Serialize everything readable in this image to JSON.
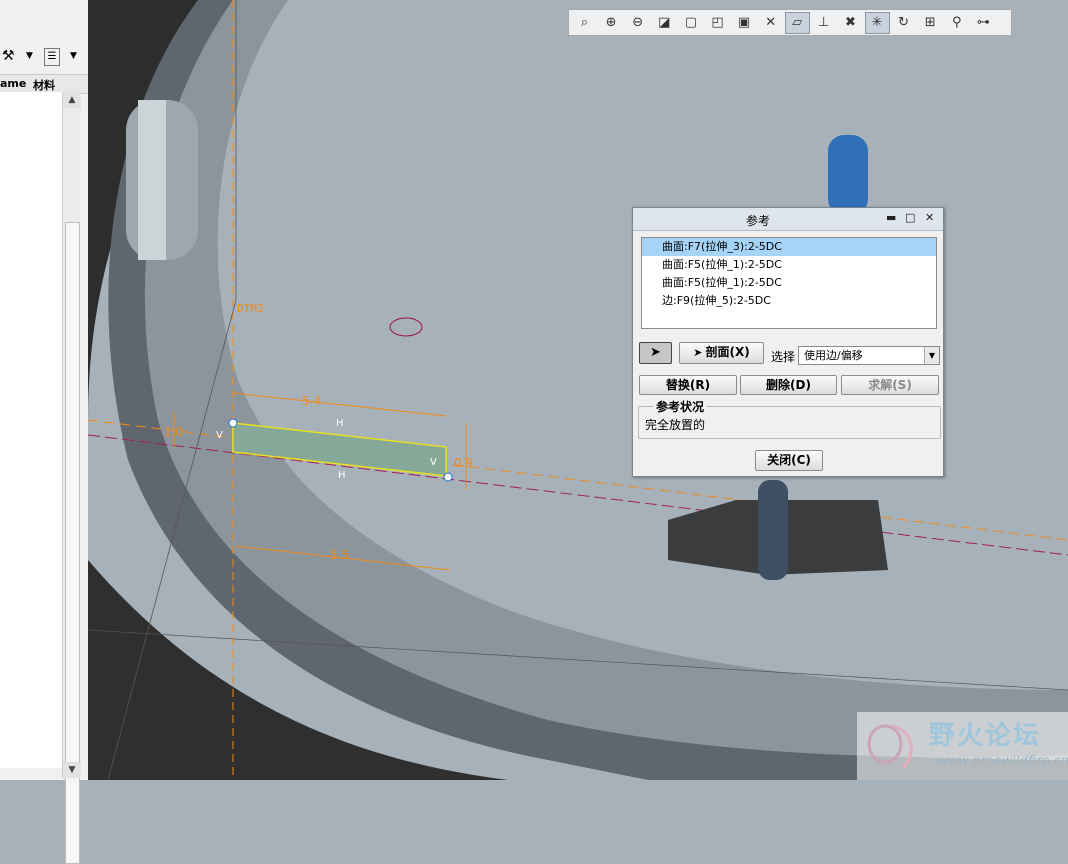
{
  "left_panel": {
    "toolbar": {
      "tool_icon": "hammer-icon",
      "list_icon": "list-settings-icon",
      "dropdown_glyph": "▼"
    },
    "columns": [
      "ame",
      "材料"
    ],
    "scroll_up": "▲",
    "scroll_down": "▼"
  },
  "view_toolbar": {
    "buttons": [
      {
        "name": "zoom-window-icon",
        "glyph": "⌕"
      },
      {
        "name": "zoom-in-icon",
        "glyph": "⊕"
      },
      {
        "name": "zoom-out-icon",
        "glyph": "⊖"
      },
      {
        "name": "refit-icon",
        "glyph": "◪"
      },
      {
        "name": "view-orientation-icon",
        "glyph": "▢"
      },
      {
        "name": "saved-views-icon",
        "glyph": "◰"
      },
      {
        "name": "camera-icon",
        "glyph": "▣"
      },
      {
        "name": "datum-display-icon",
        "glyph": "✕"
      },
      {
        "name": "plane-display-icon",
        "glyph": "▱"
      },
      {
        "name": "axis-display-icon",
        "glyph": "⊥"
      },
      {
        "name": "point-display-icon",
        "glyph": "✖"
      },
      {
        "name": "csys-display-icon",
        "glyph": "✳"
      },
      {
        "name": "refresh-icon",
        "glyph": "↻"
      },
      {
        "name": "dimension-display-icon",
        "glyph": "⊞"
      },
      {
        "name": "constraint-display-icon",
        "glyph": "⚲"
      },
      {
        "name": "vertex-display-icon",
        "glyph": "⊶"
      }
    ],
    "active_index": [
      8,
      11
    ]
  },
  "sketch": {
    "datum_label": "DTM2",
    "dim_top": "5.4",
    "dim_bottom": "5.5",
    "dim_right": "0.9",
    "dim_left": "1.0",
    "label_H_top": "H",
    "label_H_bottom": "H",
    "label_V_left": "V",
    "label_V_right": "V"
  },
  "dialog": {
    "title": "参考",
    "minimize": "▬",
    "maximize": "□",
    "close": "✕",
    "references": [
      {
        "text": "曲面:F7(拉伸_3):2-5DC",
        "selected": true
      },
      {
        "text": "曲面:F5(拉伸_1):2-5DC",
        "selected": false
      },
      {
        "text": "曲面:F5(拉伸_1):2-5DC",
        "selected": false
      },
      {
        "text": "边:F9(拉伸_5):2-5DC",
        "selected": false
      }
    ],
    "arrow_icon": "arrow-cursor-icon",
    "section_label": "剖面(X)",
    "select_label": "选择",
    "select_value": "使用边/偏移",
    "replace_label": "替换(R)",
    "delete_label": "删除(D)",
    "solve_label": "求解(S)",
    "status_legend": "参考状况",
    "status_text": "完全放置的",
    "close_label": "关闭(C)"
  },
  "watermark": {
    "name_cn": "野火论坛",
    "url": "www.proewildfire.cn"
  },
  "colors": {
    "sketch_orange": "#f08a1a",
    "viewport_bg": "#a7b1b9",
    "dialog_selected": "#a6d4f6"
  }
}
